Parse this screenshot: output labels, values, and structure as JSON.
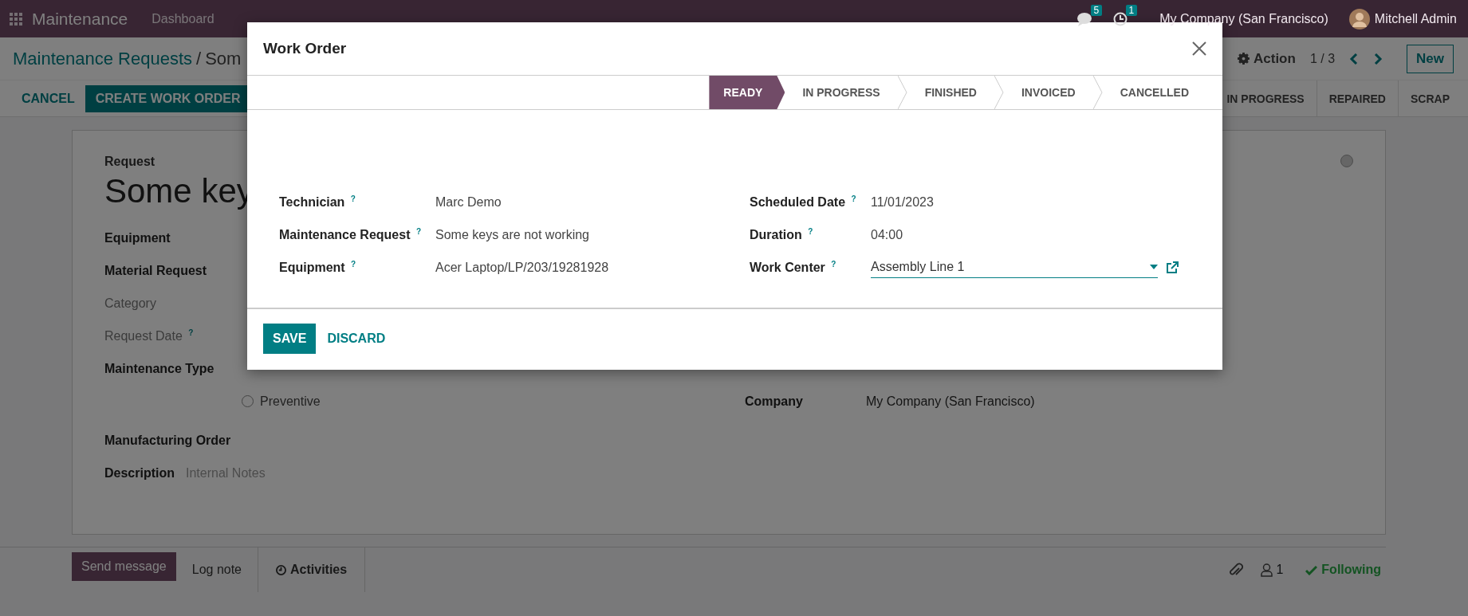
{
  "navbar": {
    "app": "Maintenance",
    "menu": [
      "Dashboard"
    ],
    "messages_count": "5",
    "activities_count": "1",
    "company": "My Company (San Francisco)",
    "user": "Mitchell Admin"
  },
  "control_panel": {
    "breadcrumb": "Maintenance Requests",
    "separator": "/",
    "current": "Som",
    "action": "Action",
    "pager": "1 / 3",
    "new_button": "New",
    "buttons": [
      {
        "label": "CANCEL",
        "kind": "link"
      },
      {
        "label": "CREATE WORK ORDER",
        "kind": "primary"
      }
    ],
    "stages": [
      "IN PROGRESS",
      "REPAIRED",
      "SCRAP"
    ]
  },
  "form": {
    "request_label": "Request",
    "title": "Some key",
    "left_fields": [
      {
        "label": "Equipment",
        "muted": false
      },
      {
        "label": "Material Request",
        "muted": false
      },
      {
        "label": "Category",
        "muted": true
      },
      {
        "label": "Request Date $^{?}$",
        "muted": true
      }
    ],
    "maintenance_type": {
      "label": "Maintenance Type",
      "options": [
        {
          "label": "Preventive",
          "selected": false
        }
      ]
    },
    "manufacturing_order": {
      "label": "Manufacturing Order"
    },
    "description": {
      "label": "Description",
      "placeholder": "Internal Notes"
    },
    "company": {
      "label": "Company",
      "value": "My Company (San Francisco)"
    }
  },
  "chatter": {
    "send_message": "Send message",
    "log_note": "Log note",
    "activities": "Activities",
    "followers_count": "1",
    "following": "Following"
  },
  "dialog": {
    "title": "Work Order",
    "stages": [
      {
        "label": "READY",
        "selected": true
      },
      {
        "label": "IN PROGRESS",
        "selected": false
      },
      {
        "label": "FINISHED",
        "selected": false
      },
      {
        "label": "INVOICED",
        "selected": false
      },
      {
        "label": "CANCELLED",
        "selected": false
      }
    ],
    "left_fields": [
      {
        "label": "Technician $^{?}$",
        "value": "Marc Demo",
        "kind": "text"
      },
      {
        "label": "Maintenance Request $^{?}$",
        "value": "Some keys are not working",
        "kind": "text"
      },
      {
        "label": "Equipment $^{?}$",
        "value": "Acer Laptop/LP/203/19281928",
        "kind": "text"
      }
    ],
    "right_fields": [
      {
        "label": "Scheduled Date $^{?}$",
        "value": "11/01/2023",
        "kind": "text"
      },
      {
        "label": "Duration $^{?}$",
        "value": "04:00",
        "kind": "text"
      },
      {
        "label": "Work Center $^{?}$",
        "value": "Assembly Line 1",
        "kind": "select"
      }
    ],
    "buttons": [
      {
        "label": "SAVE",
        "kind": "primary"
      },
      {
        "label": "DISCARD",
        "kind": "link"
      }
    ]
  }
}
